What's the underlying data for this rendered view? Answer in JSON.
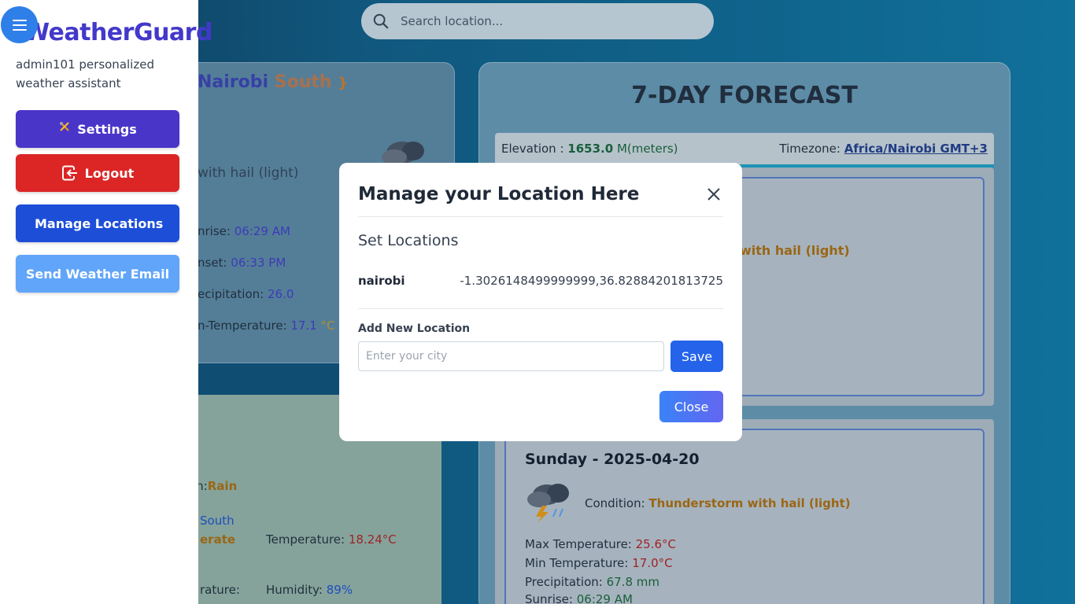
{
  "search": {
    "placeholder": "Search location..."
  },
  "current": {
    "location_part1": "Nairobi",
    "location_part2": "South",
    "location_brace": "}",
    "condition_partial": "with hail (light)",
    "sunrise_label": "nrise:",
    "sunrise_value": "06:29 AM",
    "sunset_label": "nset:",
    "sunset_value": "06:33 PM",
    "precip_label": "ecipitation:",
    "precip_value": "26.0",
    "mintemp_label": "n-Temperature:",
    "mintemp_value": "17.1",
    "mintemp_unit": "°C"
  },
  "secondary": {
    "condition_label": "on:",
    "condition_value": "Rain",
    "location_partial": "South",
    "level_partial": "erate",
    "temperature_label": "Temperature:",
    "temperature_value": "18.24°C",
    "feels_partial": "rature:",
    "humidity_label": "Humidity:",
    "humidity_value": "89%"
  },
  "forecast": {
    "title": "7-DAY FORECAST",
    "elevation_label": "Elevation :",
    "elevation_value": "1653.0",
    "elevation_unit": "M(meters)",
    "timezone_label": "Timezone:",
    "timezone_value": "Africa/Nairobi GMT+3",
    "day1_condition_partial": "with hail (light)",
    "day2": {
      "title": "Sunday - 2025-04-20",
      "condition_label": "Condition:",
      "condition_value": "Thunderstorm with hail (light)",
      "max_label": "Max Temperature:",
      "max_value": "25.6°C",
      "min_label": "Min Temperature:",
      "min_value": "17.0°C",
      "precip_label": "Precipitation:",
      "precip_value": "67.8 mm",
      "sunrise_label": "Sunrise:",
      "sunrise_value": "06:29 AM"
    }
  },
  "sidebar": {
    "brand": "WeatherGuard",
    "subtitle": "admin101 personalized weather assistant",
    "settings_label": "Settings",
    "logout_label": "Logout",
    "manage_label": "Manage Locations",
    "email_label": "Send Weather Email"
  },
  "modal": {
    "title": "Manage your Location Here",
    "subtitle": "Set Locations",
    "locations": [
      {
        "name": "nairobi",
        "coords": "-1.3026148499999999,36.82884201813725"
      }
    ],
    "add_label": "Add New Location",
    "input_placeholder": "Enter your city",
    "save_label": "Save",
    "close_label": "Close"
  }
}
